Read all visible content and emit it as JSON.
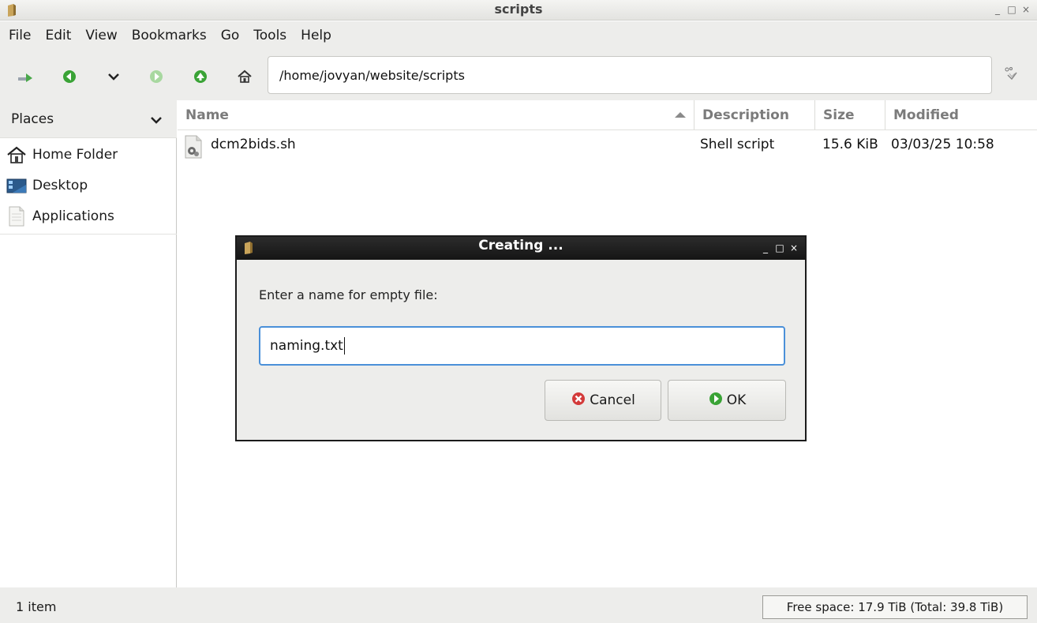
{
  "window": {
    "title": "scripts",
    "controls": [
      "_",
      "□",
      "×"
    ]
  },
  "menubar": {
    "items": [
      "File",
      "Edit",
      "View",
      "Bookmarks",
      "Go",
      "Tools",
      "Help"
    ]
  },
  "toolbar": {
    "path": "/home/jovyan/website/scripts"
  },
  "sidebar": {
    "header": "Places",
    "items": [
      {
        "label": "Home Folder",
        "icon": "home-icon"
      },
      {
        "label": "Desktop",
        "icon": "desktop-icon"
      },
      {
        "label": "Applications",
        "icon": "applications-icon"
      }
    ]
  },
  "filelist": {
    "columns": [
      "Name",
      "Description",
      "Size",
      "Modified"
    ],
    "sort": {
      "column": "Name",
      "direction": "ascending"
    },
    "rows": [
      {
        "name": "dcm2bids.sh",
        "description": "Shell script",
        "size": "15.6 KiB",
        "modified": "03/03/25 10:58",
        "icon": "shell-script-icon"
      }
    ]
  },
  "statusbar": {
    "count": "1 item",
    "free_space": "Free space: 17.9 TiB (Total: 39.8 TiB)"
  },
  "dialog": {
    "title": "Creating ...",
    "prompt": "Enter a name for empty file:",
    "input_value": "naming.txt",
    "cancel_label": "Cancel",
    "ok_label": "OK"
  },
  "colors": {
    "accent_green": "#3aa336",
    "cancel_red": "#d33a3a",
    "focus_blue": "#4a90d9",
    "dialog_titlebar": "#1b1b1b"
  }
}
